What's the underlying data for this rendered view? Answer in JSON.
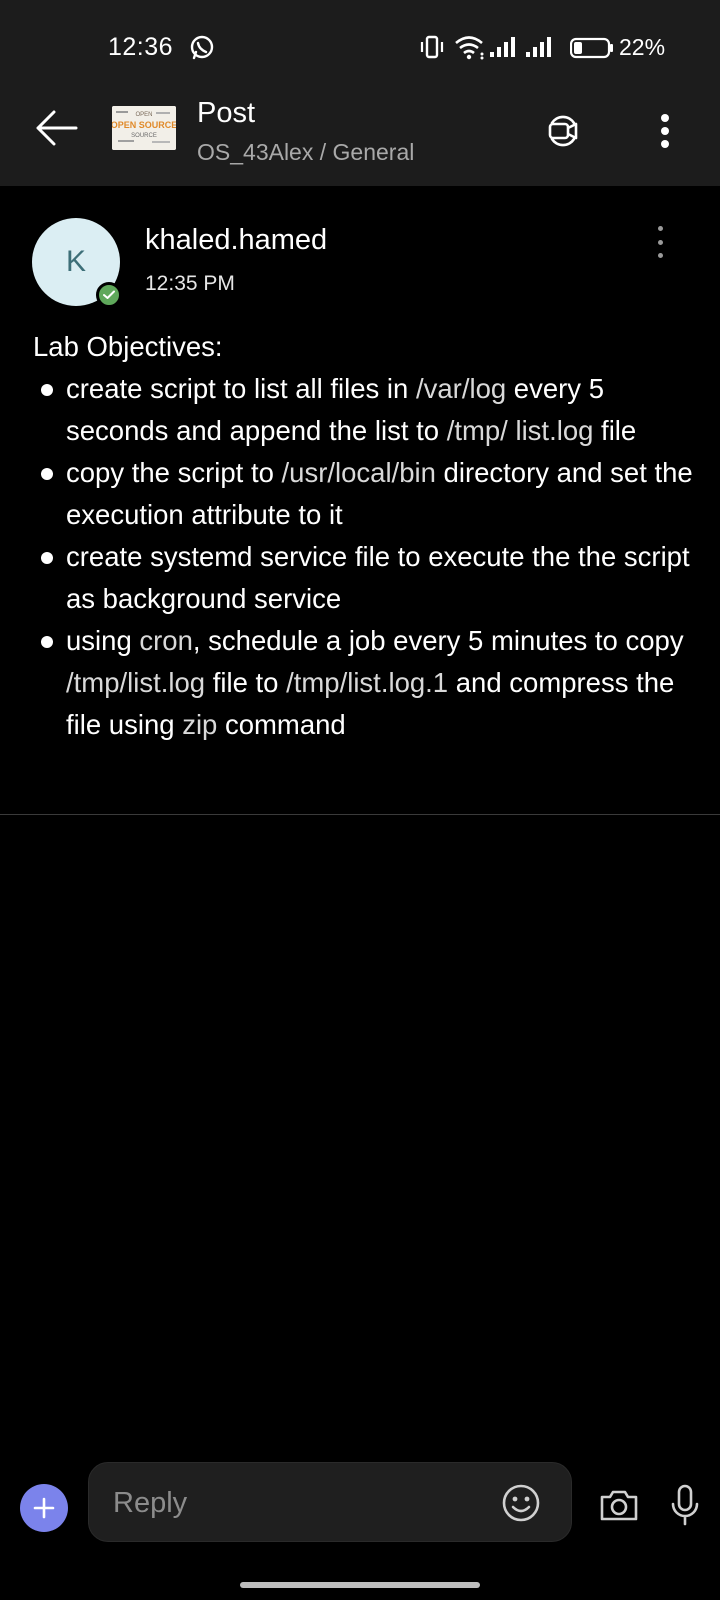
{
  "status_bar": {
    "time": "12:36",
    "battery": "22%",
    "icons": [
      "whatsapp-icon",
      "vibrate-icon",
      "wifi-icon",
      "signal-icon",
      "signal-icon",
      "battery-icon"
    ]
  },
  "header": {
    "title": "Post",
    "subtitle": "OS_43Alex / General",
    "team_image_words": [
      "OPEN",
      "OPEN SOURCE",
      "SOURCE"
    ],
    "icons": [
      "back-arrow-icon",
      "meet-video-icon",
      "more-vertical-icon"
    ]
  },
  "post": {
    "avatar_initial": "K",
    "author": "khaled.hamed",
    "time": "12:35 PM",
    "heading": "Lab Objectives:",
    "bullets": [
      [
        {
          "t": "create script to list all files in ",
          "code": false
        },
        {
          "t": "/var/log",
          "code": true
        },
        {
          "t": " every 5 seconds and append the list to ",
          "code": false
        },
        {
          "t": "/tmp/ list.log",
          "code": true
        },
        {
          "t": " file",
          "code": false
        }
      ],
      [
        {
          "t": "copy the script to ",
          "code": false
        },
        {
          "t": "/usr/local/bin",
          "code": true
        },
        {
          "t": " directory and set the execution attribute to it",
          "code": false
        }
      ],
      [
        {
          "t": "create systemd service file to execute the the script as background service",
          "code": false
        }
      ],
      [
        {
          "t": "using ",
          "code": false
        },
        {
          "t": "cron",
          "code": true
        },
        {
          "t": ", schedule a job every 5 minutes to copy ",
          "code": false
        },
        {
          "t": "/tmp/list.log",
          "code": true
        },
        {
          "t": " file to ",
          "code": false
        },
        {
          "t": "/tmp/list.log.1",
          "code": true
        },
        {
          "t": " and compress the file using ",
          "code": false
        },
        {
          "t": "zip",
          "code": true
        },
        {
          "t": " command",
          "code": false
        }
      ]
    ]
  },
  "composer": {
    "placeholder": "Reply",
    "icons": [
      "plus-icon",
      "emoji-icon",
      "camera-icon",
      "microphone-icon"
    ]
  },
  "colors": {
    "accent": "#7b83eb",
    "presence_available": "#5fa85b",
    "avatar_bg": "#dbeef3",
    "header_bg": "#1c1c1c"
  }
}
